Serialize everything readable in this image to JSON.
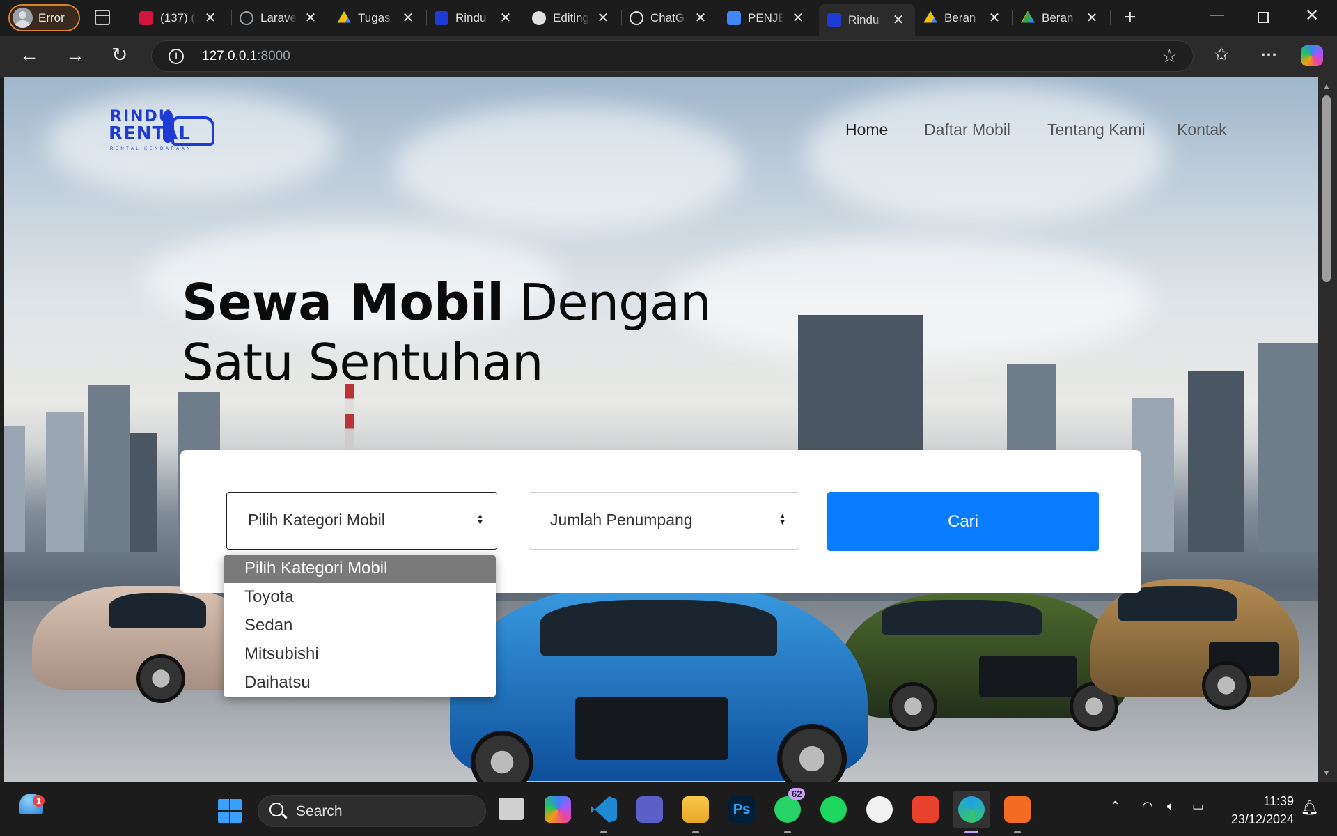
{
  "browser": {
    "profile_label": "Error",
    "tabs": [
      {
        "title": "(137) ( ",
        "fav": "#d0163e"
      },
      {
        "title": "Larave",
        "fav": "#9aa0a6"
      },
      {
        "title": "Tugas",
        "fav": "#34a853"
      },
      {
        "title": "Rindu",
        "fav": "#1f3bd6"
      },
      {
        "title": "Editing",
        "fav": "#e0e0e0"
      },
      {
        "title": "ChatG",
        "fav": "#e0e0e0"
      },
      {
        "title": "PENJE",
        "fav": "#4285f4"
      },
      {
        "title": "Rindu",
        "fav": "#1f3bd6"
      },
      {
        "title": "Beran",
        "fav": "#34a853"
      },
      {
        "title": "Beran",
        "fav": "#fbbc04"
      }
    ],
    "url_host": "127.0.0.1",
    "url_port": ":8000"
  },
  "site": {
    "logo": {
      "line1": "RINDU",
      "line2": "RENTAL",
      "tagline": "RENTAL KENDARAAN"
    },
    "nav": [
      "Home",
      "Daftar Mobil",
      "Tentang Kami",
      "Kontak"
    ],
    "hero": {
      "bold": "Sewa Mobil",
      "rest_line1": " Dengan",
      "line2": "Satu Sentuhan"
    },
    "search": {
      "category_select": "Pilih Kategori Mobil",
      "passenger_select": "Jumlah Penumpang",
      "button": "Cari"
    },
    "dropdown_options": [
      "Pilih Kategori Mobil",
      "Toyota",
      "Sedan",
      "Mitsubishi",
      "Daihatsu"
    ]
  },
  "taskbar": {
    "search_label": "Search",
    "weather_badge": "1",
    "whatsapp_badge": "62",
    "time": "11:39",
    "date": "23/12/2024"
  },
  "colors": {
    "accent": "#0a7cff",
    "brand": "#1f3bd6"
  }
}
